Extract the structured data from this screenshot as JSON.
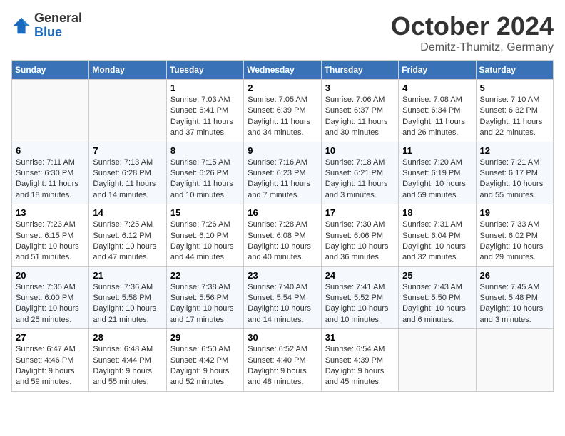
{
  "header": {
    "logo_general": "General",
    "logo_blue": "Blue",
    "month_title": "October 2024",
    "location": "Demitz-Thumitz, Germany"
  },
  "weekdays": [
    "Sunday",
    "Monday",
    "Tuesday",
    "Wednesday",
    "Thursday",
    "Friday",
    "Saturday"
  ],
  "weeks": [
    [
      {
        "day": "",
        "sunrise": "",
        "sunset": "",
        "daylight": ""
      },
      {
        "day": "",
        "sunrise": "",
        "sunset": "",
        "daylight": ""
      },
      {
        "day": "1",
        "sunrise": "Sunrise: 7:03 AM",
        "sunset": "Sunset: 6:41 PM",
        "daylight": "Daylight: 11 hours and 37 minutes."
      },
      {
        "day": "2",
        "sunrise": "Sunrise: 7:05 AM",
        "sunset": "Sunset: 6:39 PM",
        "daylight": "Daylight: 11 hours and 34 minutes."
      },
      {
        "day": "3",
        "sunrise": "Sunrise: 7:06 AM",
        "sunset": "Sunset: 6:37 PM",
        "daylight": "Daylight: 11 hours and 30 minutes."
      },
      {
        "day": "4",
        "sunrise": "Sunrise: 7:08 AM",
        "sunset": "Sunset: 6:34 PM",
        "daylight": "Daylight: 11 hours and 26 minutes."
      },
      {
        "day": "5",
        "sunrise": "Sunrise: 7:10 AM",
        "sunset": "Sunset: 6:32 PM",
        "daylight": "Daylight: 11 hours and 22 minutes."
      }
    ],
    [
      {
        "day": "6",
        "sunrise": "Sunrise: 7:11 AM",
        "sunset": "Sunset: 6:30 PM",
        "daylight": "Daylight: 11 hours and 18 minutes."
      },
      {
        "day": "7",
        "sunrise": "Sunrise: 7:13 AM",
        "sunset": "Sunset: 6:28 PM",
        "daylight": "Daylight: 11 hours and 14 minutes."
      },
      {
        "day": "8",
        "sunrise": "Sunrise: 7:15 AM",
        "sunset": "Sunset: 6:26 PM",
        "daylight": "Daylight: 11 hours and 10 minutes."
      },
      {
        "day": "9",
        "sunrise": "Sunrise: 7:16 AM",
        "sunset": "Sunset: 6:23 PM",
        "daylight": "Daylight: 11 hours and 7 minutes."
      },
      {
        "day": "10",
        "sunrise": "Sunrise: 7:18 AM",
        "sunset": "Sunset: 6:21 PM",
        "daylight": "Daylight: 11 hours and 3 minutes."
      },
      {
        "day": "11",
        "sunrise": "Sunrise: 7:20 AM",
        "sunset": "Sunset: 6:19 PM",
        "daylight": "Daylight: 10 hours and 59 minutes."
      },
      {
        "day": "12",
        "sunrise": "Sunrise: 7:21 AM",
        "sunset": "Sunset: 6:17 PM",
        "daylight": "Daylight: 10 hours and 55 minutes."
      }
    ],
    [
      {
        "day": "13",
        "sunrise": "Sunrise: 7:23 AM",
        "sunset": "Sunset: 6:15 PM",
        "daylight": "Daylight: 10 hours and 51 minutes."
      },
      {
        "day": "14",
        "sunrise": "Sunrise: 7:25 AM",
        "sunset": "Sunset: 6:12 PM",
        "daylight": "Daylight: 10 hours and 47 minutes."
      },
      {
        "day": "15",
        "sunrise": "Sunrise: 7:26 AM",
        "sunset": "Sunset: 6:10 PM",
        "daylight": "Daylight: 10 hours and 44 minutes."
      },
      {
        "day": "16",
        "sunrise": "Sunrise: 7:28 AM",
        "sunset": "Sunset: 6:08 PM",
        "daylight": "Daylight: 10 hours and 40 minutes."
      },
      {
        "day": "17",
        "sunrise": "Sunrise: 7:30 AM",
        "sunset": "Sunset: 6:06 PM",
        "daylight": "Daylight: 10 hours and 36 minutes."
      },
      {
        "day": "18",
        "sunrise": "Sunrise: 7:31 AM",
        "sunset": "Sunset: 6:04 PM",
        "daylight": "Daylight: 10 hours and 32 minutes."
      },
      {
        "day": "19",
        "sunrise": "Sunrise: 7:33 AM",
        "sunset": "Sunset: 6:02 PM",
        "daylight": "Daylight: 10 hours and 29 minutes."
      }
    ],
    [
      {
        "day": "20",
        "sunrise": "Sunrise: 7:35 AM",
        "sunset": "Sunset: 6:00 PM",
        "daylight": "Daylight: 10 hours and 25 minutes."
      },
      {
        "day": "21",
        "sunrise": "Sunrise: 7:36 AM",
        "sunset": "Sunset: 5:58 PM",
        "daylight": "Daylight: 10 hours and 21 minutes."
      },
      {
        "day": "22",
        "sunrise": "Sunrise: 7:38 AM",
        "sunset": "Sunset: 5:56 PM",
        "daylight": "Daylight: 10 hours and 17 minutes."
      },
      {
        "day": "23",
        "sunrise": "Sunrise: 7:40 AM",
        "sunset": "Sunset: 5:54 PM",
        "daylight": "Daylight: 10 hours and 14 minutes."
      },
      {
        "day": "24",
        "sunrise": "Sunrise: 7:41 AM",
        "sunset": "Sunset: 5:52 PM",
        "daylight": "Daylight: 10 hours and 10 minutes."
      },
      {
        "day": "25",
        "sunrise": "Sunrise: 7:43 AM",
        "sunset": "Sunset: 5:50 PM",
        "daylight": "Daylight: 10 hours and 6 minutes."
      },
      {
        "day": "26",
        "sunrise": "Sunrise: 7:45 AM",
        "sunset": "Sunset: 5:48 PM",
        "daylight": "Daylight: 10 hours and 3 minutes."
      }
    ],
    [
      {
        "day": "27",
        "sunrise": "Sunrise: 6:47 AM",
        "sunset": "Sunset: 4:46 PM",
        "daylight": "Daylight: 9 hours and 59 minutes."
      },
      {
        "day": "28",
        "sunrise": "Sunrise: 6:48 AM",
        "sunset": "Sunset: 4:44 PM",
        "daylight": "Daylight: 9 hours and 55 minutes."
      },
      {
        "day": "29",
        "sunrise": "Sunrise: 6:50 AM",
        "sunset": "Sunset: 4:42 PM",
        "daylight": "Daylight: 9 hours and 52 minutes."
      },
      {
        "day": "30",
        "sunrise": "Sunrise: 6:52 AM",
        "sunset": "Sunset: 4:40 PM",
        "daylight": "Daylight: 9 hours and 48 minutes."
      },
      {
        "day": "31",
        "sunrise": "Sunrise: 6:54 AM",
        "sunset": "Sunset: 4:39 PM",
        "daylight": "Daylight: 9 hours and 45 minutes."
      },
      {
        "day": "",
        "sunrise": "",
        "sunset": "",
        "daylight": ""
      },
      {
        "day": "",
        "sunrise": "",
        "sunset": "",
        "daylight": ""
      }
    ]
  ]
}
